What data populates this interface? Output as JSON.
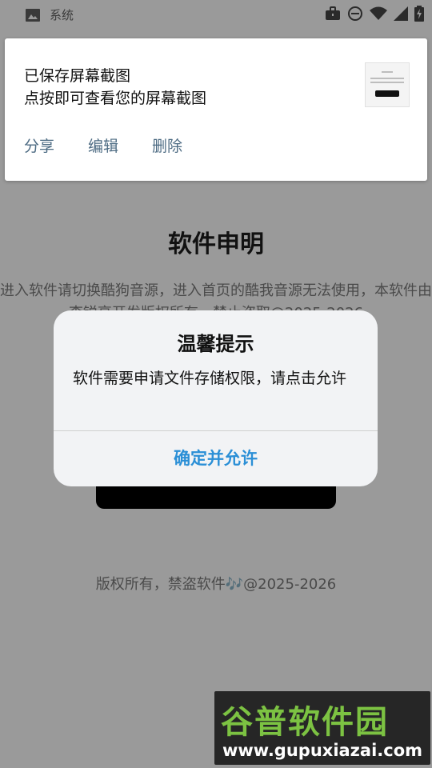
{
  "status_bar": {
    "app_label": "系统",
    "icons": [
      "image-icon",
      "briefcase-icon",
      "do-not-disturb-icon",
      "wifi-icon",
      "signal-icon",
      "battery-icon"
    ]
  },
  "notification": {
    "title": "已保存屏幕截图",
    "subtitle": "点按即可查看您的屏幕截图",
    "actions": [
      "分享",
      "编辑",
      "删除"
    ],
    "action_color": "#4d6b83"
  },
  "page": {
    "title": "软件申明",
    "notice": "进入软件请切换酷狗音源，进入首页的酷我音源无法使用，本软件由李锐亮开发版权所有，禁止盗取@2025-2026",
    "copyright": "版权所有，禁盗软件🎶@2025-2026"
  },
  "dialog": {
    "title": "温馨提示",
    "message": "软件需要申请文件存储权限，请点击允许",
    "confirm_label": "确定并允许",
    "confirm_color": "#2b8fd6"
  },
  "watermark": {
    "logo_text": "谷普软件园",
    "url": "www.gupuxiazai.com"
  }
}
